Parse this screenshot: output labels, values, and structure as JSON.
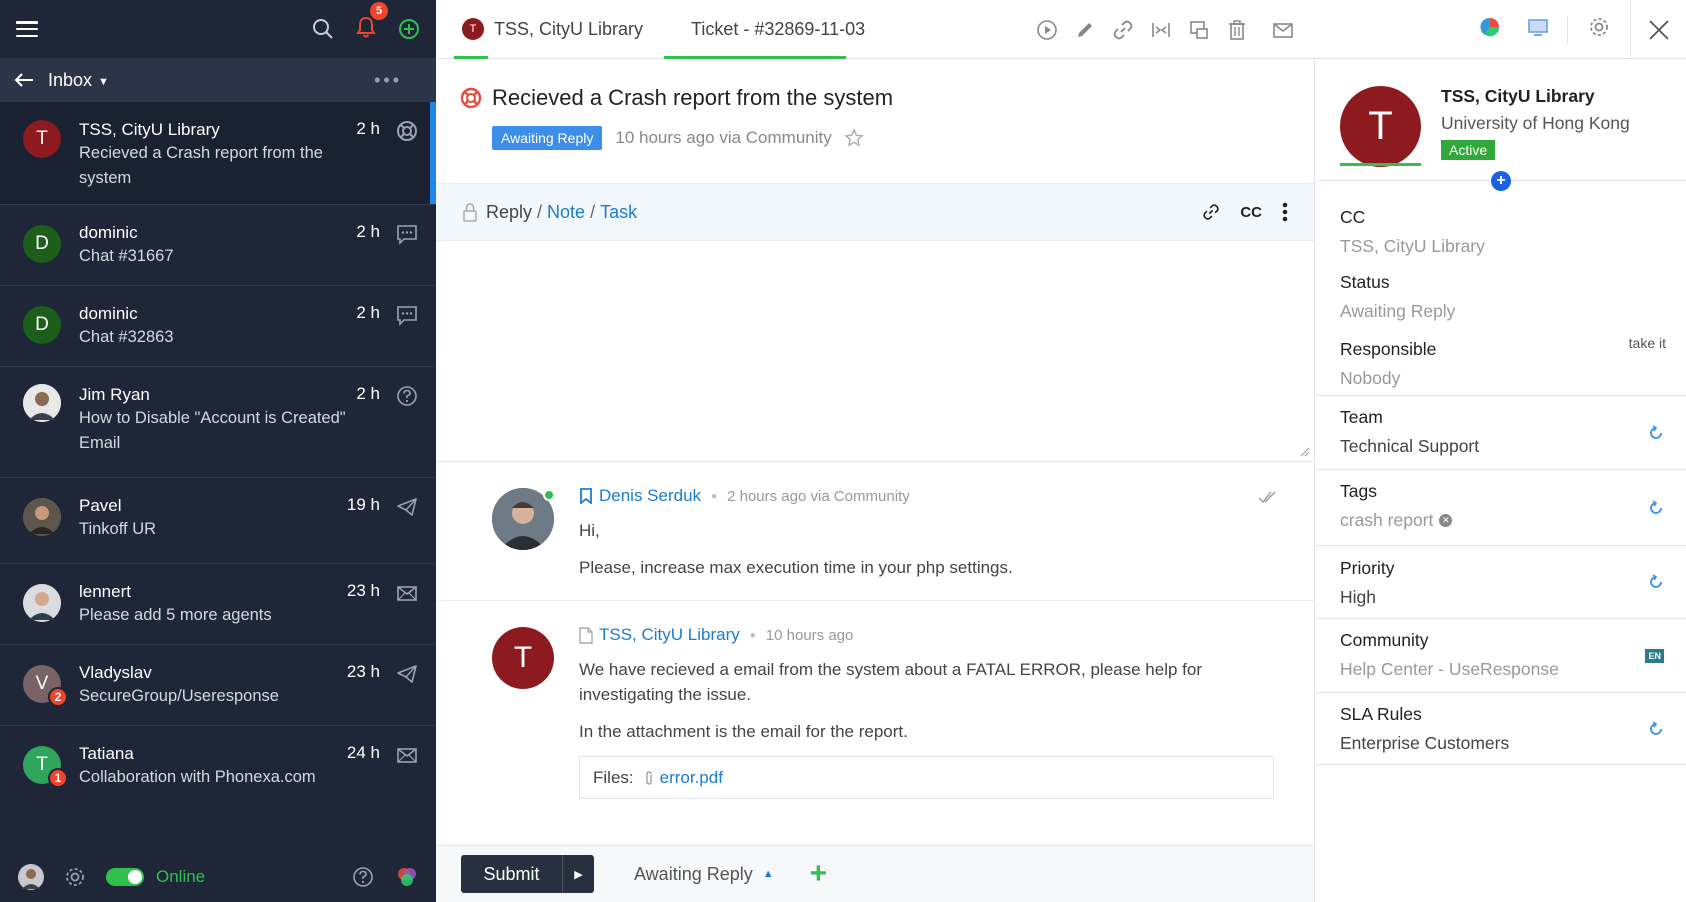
{
  "sidebar": {
    "notification_count": "5",
    "inbox_label": "Inbox",
    "conversations": [
      {
        "initial": "T",
        "name": "TSS, CityU Library",
        "snippet": "Recieved a Crash report from the system",
        "time": "2 h",
        "avatar_color": "#8c1a1f",
        "icon": "lifebuoy-icon"
      },
      {
        "initial": "D",
        "name": "dominic",
        "snippet": "Chat #31667",
        "time": "2 h",
        "avatar_color": "#1d5e1a",
        "icon": "chat-icon"
      },
      {
        "initial": "D",
        "name": "dominic",
        "snippet": "Chat #32863",
        "time": "2 h",
        "avatar_color": "#1d5e1a",
        "icon": "chat-icon"
      },
      {
        "initial": "",
        "name": "Jim Ryan",
        "snippet": "How to Disable \"Account is Created\" Email",
        "time": "2 h",
        "avatar_color": "#c7c9cc",
        "icon": "question-icon"
      },
      {
        "initial": "",
        "name": "Pavel",
        "snippet": "Tinkoff UR",
        "time": "19 h",
        "avatar_color": "#6b6257",
        "icon": "telegram-icon"
      },
      {
        "initial": "",
        "name": "lennert",
        "snippet": "Please add 5 more agents",
        "time": "23 h",
        "avatar_color": "#8a9097",
        "icon": "mail-icon"
      },
      {
        "initial": "V",
        "name": "Vladyslav",
        "snippet": "SecureGroup/Useresponse",
        "time": "23 h",
        "avatar_color": "#7a6364",
        "icon": "telegram-icon",
        "badge": "2"
      },
      {
        "initial": "T",
        "name": "Tatiana",
        "snippet": "Collaboration with Phonexa.com",
        "time": "24 h",
        "avatar_color": "#2fa65b",
        "icon": "mail-icon",
        "badge": "1"
      }
    ],
    "status_label": "Online"
  },
  "topbar": {
    "tab_contact": "TSS, CityU Library",
    "tab_contact_initial": "T",
    "tab_ticket": "Ticket - #32869-11-03"
  },
  "ticket": {
    "title": "Recieved a Crash report from the system",
    "status": "Awaiting Reply",
    "meta": "10 hours ago via Community"
  },
  "reply": {
    "reply_label": "Reply",
    "note_label": "Note",
    "task_label": "Task",
    "cc_label": "CC"
  },
  "messages": [
    {
      "author": "Denis Serduk",
      "when": "2 hours ago via Community",
      "paragraphs": [
        "Hi,",
        "Please, increase max execution time in your php settings."
      ]
    },
    {
      "author": "TSS, CityU Library",
      "initial": "T",
      "when": "10 hours ago",
      "paragraphs": [
        "We have recieved a email from the system about a FATAL ERROR, please help for investigating the issue.",
        "In the attachment is the email for the report."
      ],
      "files_label": "Files:",
      "file": "error.pdf"
    }
  ],
  "footer": {
    "submit_label": "Submit",
    "status_select": "Awaiting Reply"
  },
  "panel": {
    "contact_initial": "T",
    "contact_name": "TSS, CityU Library",
    "contact_org": "University of Hong Kong",
    "contact_status": "Active",
    "fields": {
      "cc": {
        "label": "CC",
        "value": "TSS, CityU Library"
      },
      "status": {
        "label": "Status",
        "value": "Awaiting Reply"
      },
      "responsible": {
        "label": "Responsible",
        "value": "Nobody",
        "action": "take it"
      },
      "team": {
        "label": "Team",
        "value": "Technical Support"
      },
      "tags": {
        "label": "Tags",
        "value": "crash report"
      },
      "priority": {
        "label": "Priority",
        "value": "High"
      },
      "community": {
        "label": "Community",
        "value": "Help Center - UseResponse",
        "lang": "EN"
      },
      "sla": {
        "label": "SLA Rules",
        "value": "Enterprise Customers"
      }
    }
  }
}
